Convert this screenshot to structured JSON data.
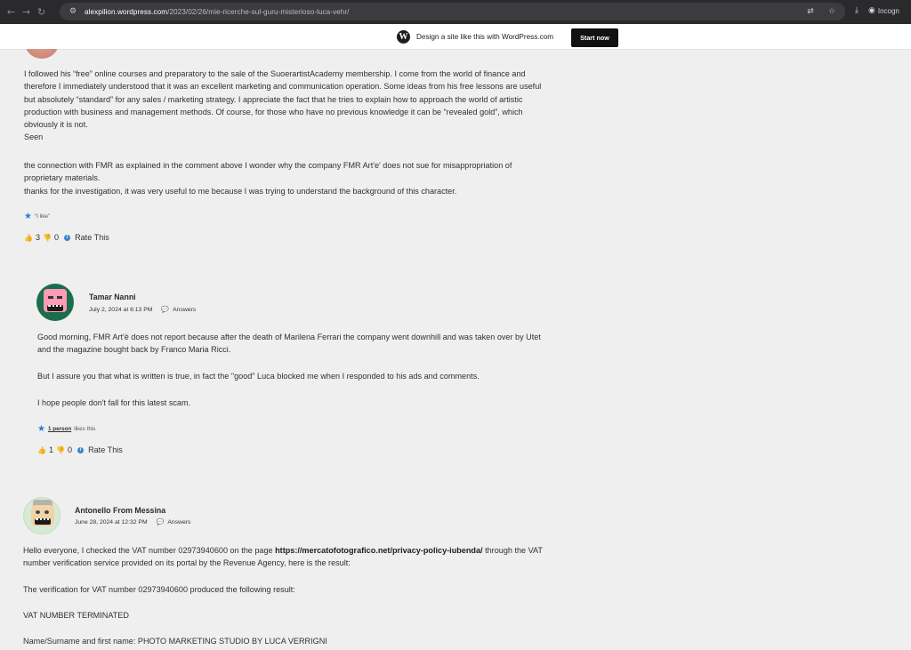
{
  "browser": {
    "url_host": "alexpilion.wordpress.com",
    "url_path": "/2023/02/26/mie-ricerche-sul-guru-misterioso-luca-vehr/",
    "incognito_label": "Incogn"
  },
  "wp_banner": {
    "text": "Design a site like this with WordPress.com",
    "button": "Start now"
  },
  "comment1": {
    "lines": [
      "I followed his “free” online courses and preparatory to the sale of the SuoerartistAcademy membership. I come from the world of finance and",
      "therefore I immediately understood that it was an excellent marketing and communication operation. Some ideas from his free lessons are useful",
      "but absolutely “standard” for any sales / marketing strategy. I appreciate the fact that he tries to explain how to approach the world of artistic",
      "production with business and management methods. Of course, for those who have no previous knowledge it can be “revealed gold”, which",
      "obviously it is not.",
      "Seen"
    ],
    "lines2": [
      "the connection with FMR as explained in the comment above I wonder why the company FMR Art'e' does not sue for misappropriation of",
      "proprietary materials.",
      "thanks for the investigation, it was very useful to me because I was trying to understand the background of this character."
    ],
    "like_label": "“I like”",
    "up_count": "3",
    "down_count": "0",
    "rate_label": "Rate This"
  },
  "comment2": {
    "author": "Tamar Nanni",
    "date": "July 2, 2024 at 6:13 PM",
    "answers": "Answers",
    "para1": [
      "Good morning, FMR Art'è does not report because after the death of Marilena Ferrari the company went downhill and was taken over by Utet",
      "and the magazine bought back by Franco Maria Ricci."
    ],
    "para2": "But I assure you that what is written is true, in fact the \"good\" Luca blocked me when I responded to his ads and comments.",
    "para3": "I hope people don't fall for this latest scam.",
    "likes_link": "1 person",
    "likes_text": "likes this",
    "up_count": "1",
    "down_count": "0",
    "rate_label": "Rate This"
  },
  "comment3": {
    "author": "Antonello From Messina",
    "date": "June 28, 2024 at 12:32 PM",
    "answers": "Answers",
    "para1_pre": "Hello everyone, I checked the VAT number 02973940600 on the page ",
    "para1_link": "https://mercatofotografico.net/privacy-policy-iubenda/",
    "para1_post": " through the VAT",
    "para1_line2": "number verification service provided on its portal by the Revenue Agency, here is the result:",
    "para2": "The verification for VAT number 02973940600 produced the following result:",
    "para3": "VAT NUMBER TERMINATED",
    "para4": "Name/Surname and first name: PHOTO MARKETING STUDIO BY LUCA VERRIGNI"
  }
}
